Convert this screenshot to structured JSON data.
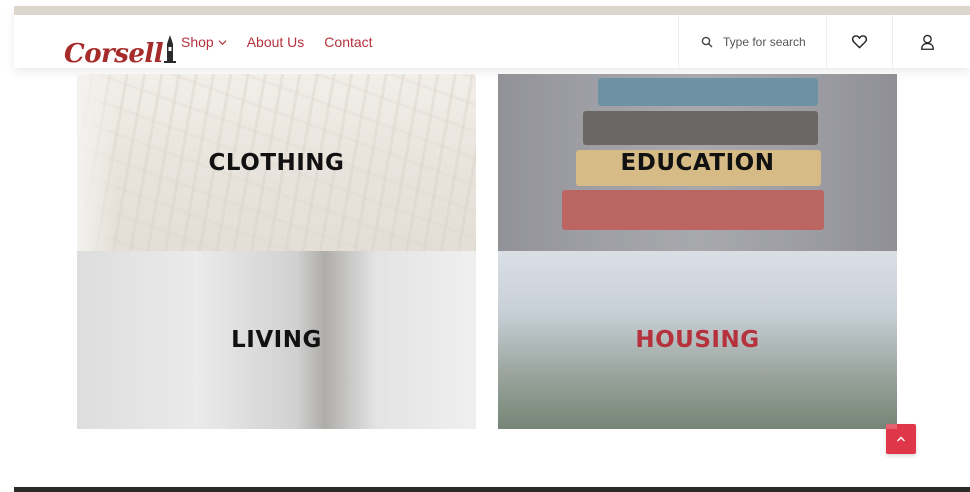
{
  "brand": {
    "name": "Corsell",
    "color": "#a62b2b"
  },
  "nav": {
    "items": [
      {
        "label": "Shop",
        "has_dropdown": true
      },
      {
        "label": "About Us",
        "has_dropdown": false
      },
      {
        "label": "Contact",
        "has_dropdown": false
      }
    ],
    "color": "#b5323c"
  },
  "search": {
    "placeholder": "Type for search",
    "icon": "search-icon"
  },
  "header_icons": {
    "wishlist": "heart-icon",
    "account": "user-icon"
  },
  "categories": [
    {
      "label": "CLOTHING",
      "label_color": "#111111"
    },
    {
      "label": "EDUCATION",
      "label_color": "#111111"
    },
    {
      "label": "LIVING",
      "label_color": "#111111"
    },
    {
      "label": "HOUSING",
      "label_color": "#b5323c"
    }
  ],
  "back_to_top": {
    "icon": "chevron-up-icon",
    "color": "#e0364a"
  }
}
